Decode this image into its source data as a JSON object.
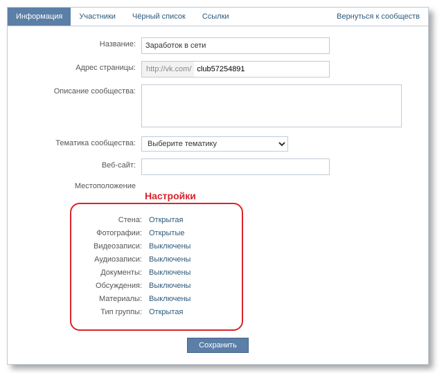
{
  "tabs": {
    "info": "Информация",
    "members": "Участники",
    "blacklist": "Чёрный список",
    "links": "Ссылки",
    "back": "Вернуться к сообществ"
  },
  "form": {
    "name_label": "Название:",
    "name_value": "Заработок в сети",
    "address_label": "Адрес страницы:",
    "address_prefix": "http://vk.com/",
    "address_value": "club57254891",
    "desc_label": "Описание сообщества:",
    "desc_value": "",
    "topic_label": "Тематика сообщества:",
    "topic_value": "Выберите тематику",
    "website_label": "Веб-сайт:",
    "website_value": "",
    "location_label": "Местоположение"
  },
  "settings": {
    "title": "Настройки",
    "rows": [
      {
        "label": "Стена:",
        "value": "Открытая"
      },
      {
        "label": "Фотографии:",
        "value": "Открытые"
      },
      {
        "label": "Видеозаписи:",
        "value": "Выключены"
      },
      {
        "label": "Аудиозаписи:",
        "value": "Выключены"
      },
      {
        "label": "Документы:",
        "value": "Выключены"
      },
      {
        "label": "Обсуждения:",
        "value": "Выключены"
      },
      {
        "label": "Материалы:",
        "value": "Выключены"
      },
      {
        "label": "Тип группы:",
        "value": "Открытая"
      }
    ]
  },
  "save": "Сохранить"
}
